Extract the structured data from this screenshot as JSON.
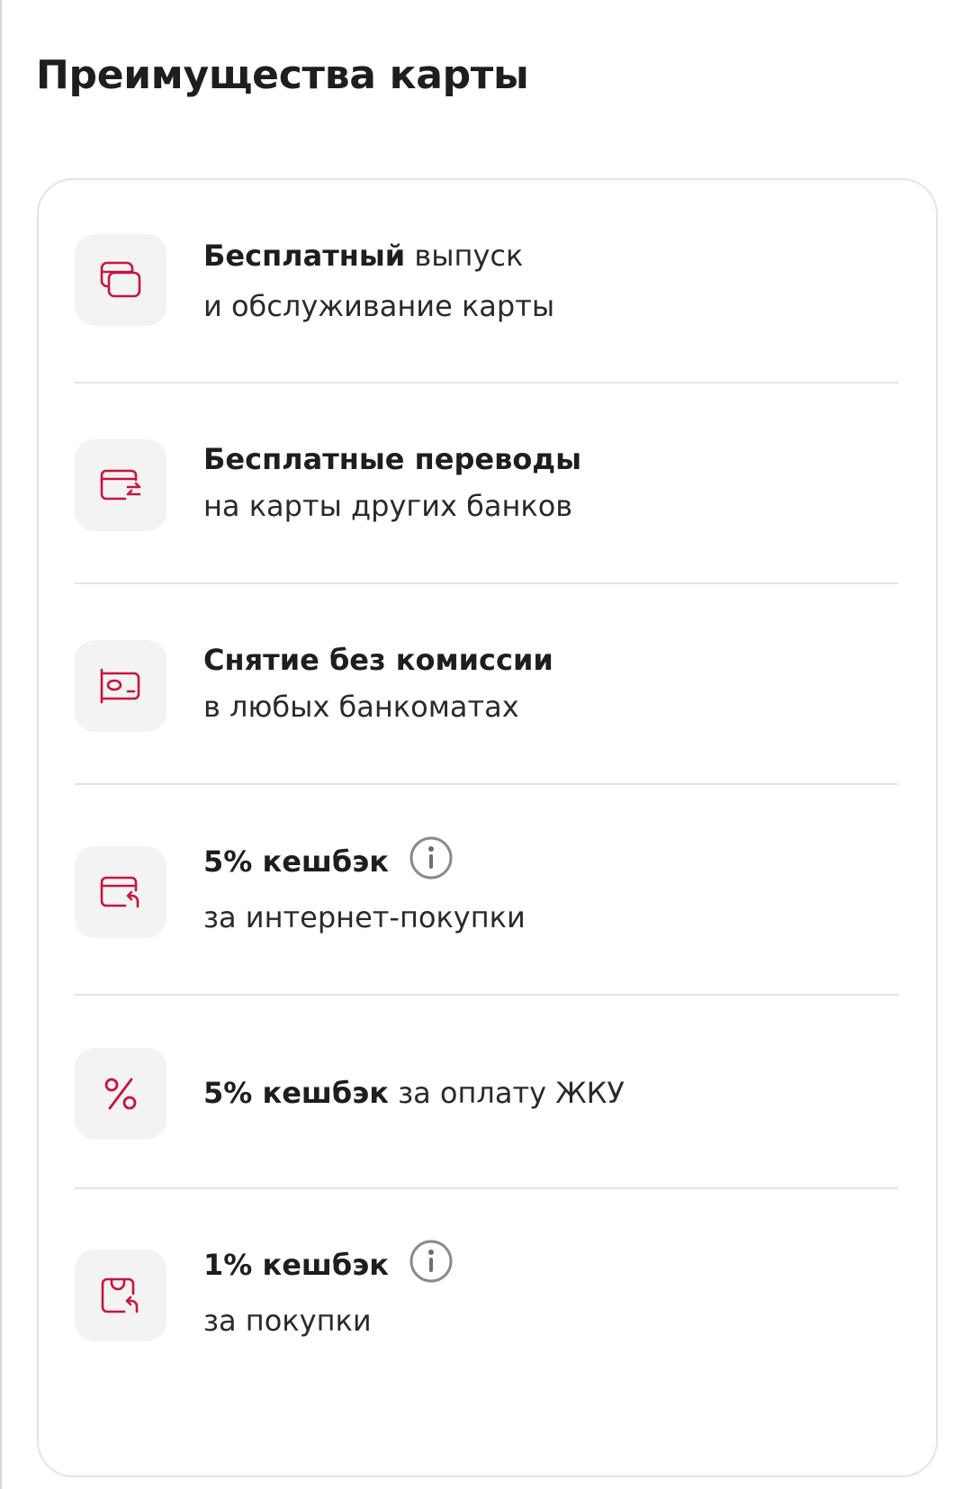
{
  "page_title": "Преимущества карты",
  "colors": {
    "accent": "#c8143c",
    "icon_bg": "#f3f3f4",
    "divider": "#e3e3e3",
    "info": "#8a8a8a"
  },
  "benefits": [
    {
      "icon": "cards-stack-icon",
      "bold": "Бесплатный",
      "rest": " выпуск",
      "line2": "и обслуживание карты",
      "info": false
    },
    {
      "icon": "card-transfer-icon",
      "bold": "Бесплатные переводы",
      "rest": "",
      "line2": "на карты других банков",
      "info": false
    },
    {
      "icon": "cash-withdrawal-icon",
      "bold": "Снятие без комиссии",
      "rest": "",
      "line2": "в любых банкоматах",
      "info": false
    },
    {
      "icon": "card-cashback-icon",
      "bold": "5% кешбэк",
      "rest": "",
      "line2": "за интернет-покупки",
      "info": true
    },
    {
      "icon": "percent-icon",
      "bold": "5% кешбэк",
      "rest": " за оплату ЖКУ",
      "line2": "",
      "info": false
    },
    {
      "icon": "shopping-bag-cashback-icon",
      "bold": "1% кешбэк",
      "rest": "",
      "line2": "за покупки",
      "info": true
    }
  ]
}
